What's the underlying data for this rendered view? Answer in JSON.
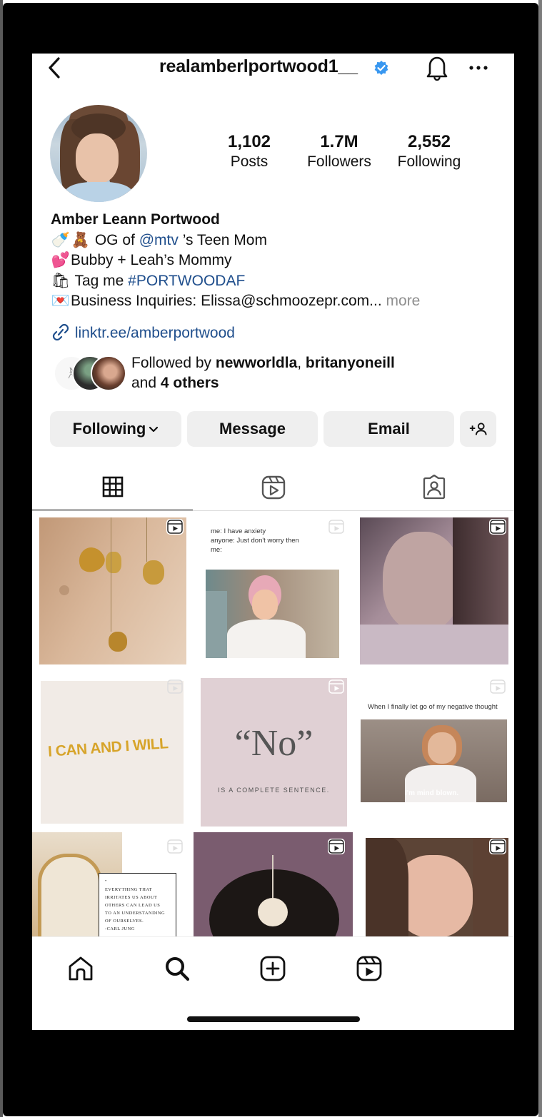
{
  "header": {
    "username": "realamberlportwood1__"
  },
  "stats": {
    "posts_count": "1,102",
    "posts_label": "Posts",
    "followers_count": "1.7M",
    "followers_label": "Followers",
    "following_count": "2,552",
    "following_label": "Following"
  },
  "bio": {
    "name": "Amber Leann Portwood",
    "line1_pre": "OG of ",
    "line1_mention": "@mtv",
    "line1_post": " ’s Teen Mom",
    "line2": "Bubby + Leah’s Mommy",
    "line3_pre": "Tag me ",
    "line3_hashtag": "#PORTWOODAF",
    "line4": "Business Inquiries:  Elissa@schmoozepr.com...",
    "more": "more",
    "link": "linktr.ee/amberportwood"
  },
  "followed_by": {
    "prefix": "Followed by ",
    "user1": "newworldla",
    "sep": ", ",
    "user2": "britanyoneill",
    "and": "and ",
    "others": "4 others"
  },
  "buttons": {
    "following": "Following",
    "message": "Message",
    "email": "Email",
    "add_person": "+ person"
  },
  "posts": {
    "p2_text": "me: I have anxiety\nanyone: Just don't worry then\nme:",
    "p4_text": "I CAN AND I WILL",
    "p5_big": "“No”",
    "p5_small": "IS A COMPLETE SENTENCE.",
    "p6_text": "When I finally let go of my negative thought",
    "p6_caption": "I'm mind blown.",
    "p7_text": "\"\nEVERYTHING THAT\nIRRITATES US ABOUT\nOTHERS CAN LEAD US\nTO AN UNDERSTANDING\nOF OURSELVES.\n-CARL JUNG"
  },
  "icons": [
    "back-arrow-icon",
    "verified-badge-icon",
    "bell-icon",
    "more-icon",
    "link-icon",
    "grid-icon",
    "reels-icon",
    "tagged-icon",
    "home-icon",
    "search-icon",
    "create-icon",
    "reels-nav-icon"
  ],
  "colors": {
    "link": "#1f4e8c",
    "verified": "#3897f0",
    "button_bg": "#efefef"
  }
}
